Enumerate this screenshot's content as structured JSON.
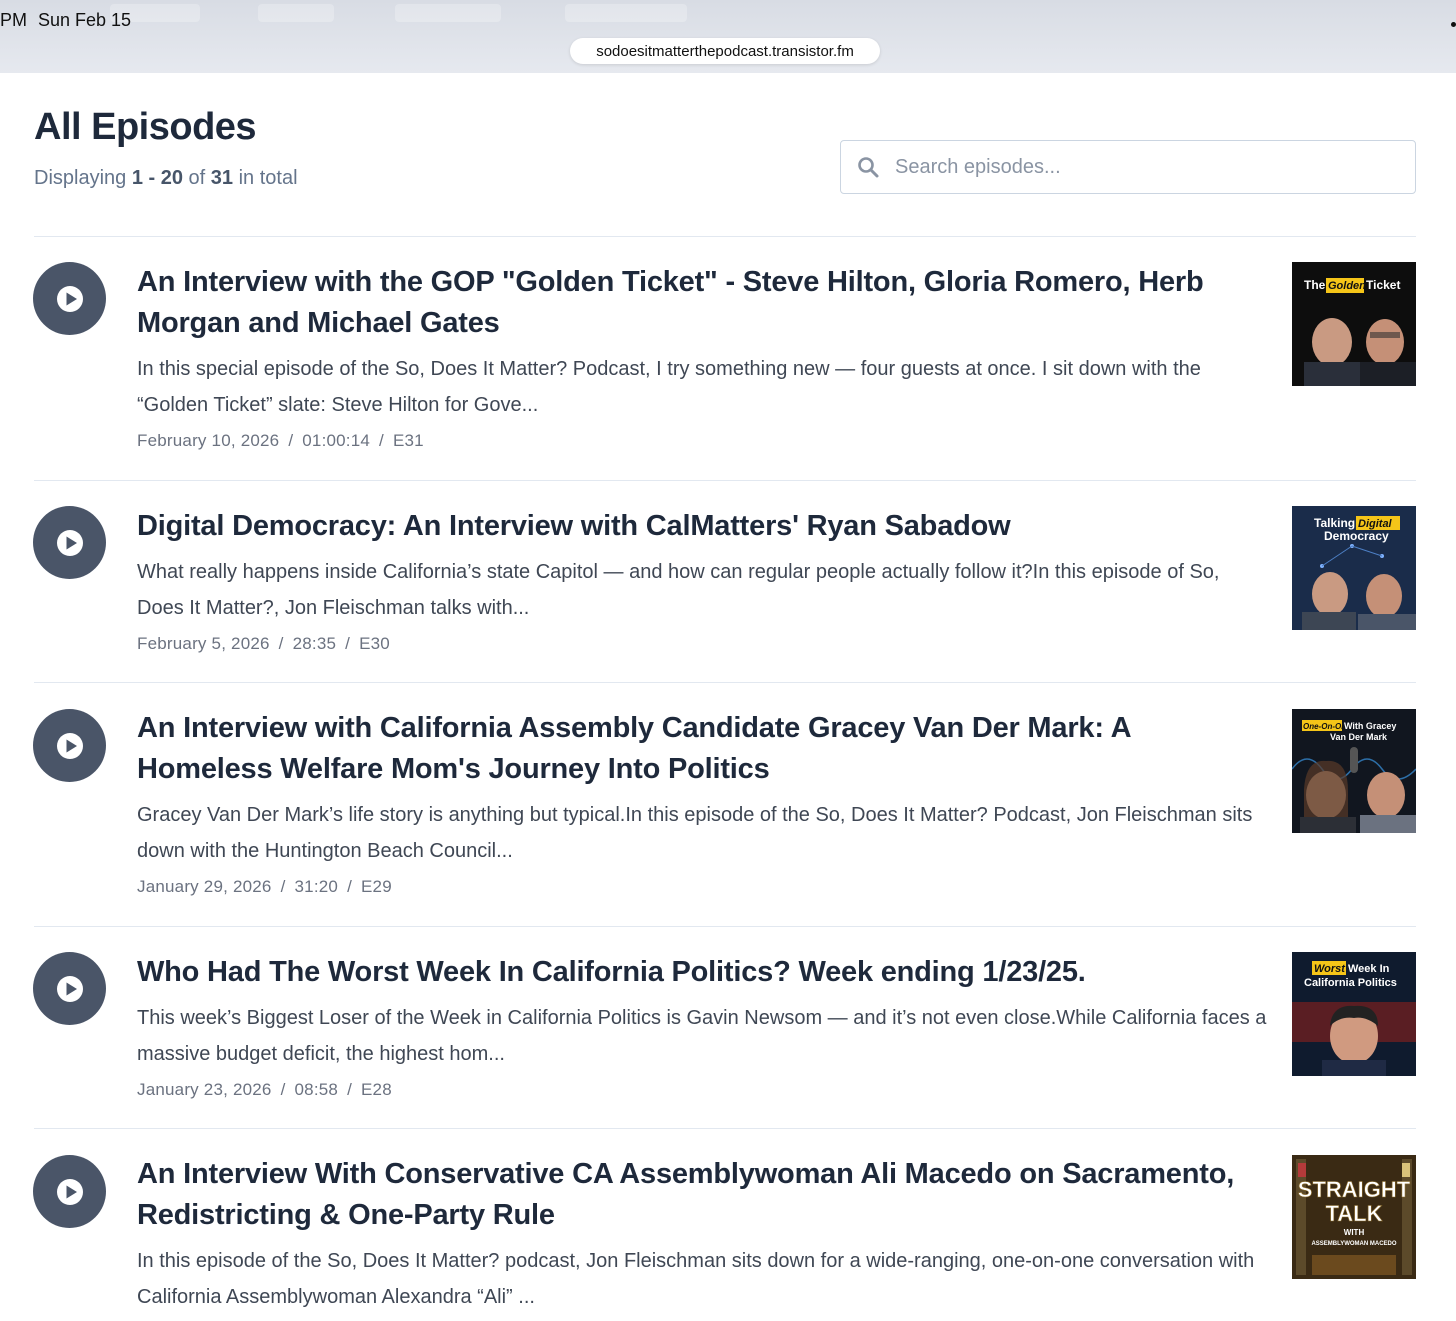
{
  "status_bar": {
    "time": "PM",
    "date": "Sun Feb 15"
  },
  "browser": {
    "url": "sodoesitmatterthepodcast.transistor.fm"
  },
  "header": {
    "title": "All Episodes",
    "displaying_prefix": "Displaying",
    "range": "1 - 20",
    "of_word": "of",
    "total": "31",
    "suffix": "in total"
  },
  "search": {
    "placeholder": "Search episodes..."
  },
  "episodes": [
    {
      "title": "An Interview with the GOP \"Golden Ticket\" - Steve Hilton, Gloria Romero, Herb Morgan and Michael Gates",
      "description": "In this special episode of the So, Does It Matter? Podcast, I try something new — four guests at once. I sit down with the “Golden Ticket” slate: Steve Hilton for Gove...",
      "date": "February 10, 2026",
      "duration": "01:00:14",
      "number": "E31",
      "thumb_lines": [
        "The",
        "Golden",
        "Ticket"
      ]
    },
    {
      "title": "Digital Democracy: An Interview with CalMatters' Ryan Sabadow",
      "description": "What really happens inside California’s state Capitol — and how can regular people actually follow it?In this episode of So, Does It Matter?, Jon Fleischman talks with...",
      "date": "February 5, 2026",
      "duration": "28:35",
      "number": "E30",
      "thumb_lines": [
        "Talking",
        "Digital",
        "Democracy"
      ]
    },
    {
      "title": "An Interview with California Assembly Candidate Gracey Van Der Mark: A Homeless Welfare Mom's Journey Into Politics",
      "description": "Gracey Van Der Mark’s life story is anything but typical.In this episode of the So, Does It Matter? Podcast, Jon Fleischman sits down with the Huntington Beach Council...",
      "date": "January 29, 2026",
      "duration": "31:20",
      "number": "E29",
      "thumb_lines": [
        "One-On-One",
        "With Gracey",
        "Van Der Mark"
      ]
    },
    {
      "title": "Who Had The Worst Week In California Politics? Week ending 1/23/25.",
      "description": "This week’s Biggest Loser of the Week in California Politics is Gavin Newsom — and it’s not even close.While California faces a massive budget deficit, the highest hom...",
      "date": "January 23, 2026",
      "duration": "08:58",
      "number": "E28",
      "thumb_lines": [
        "Worst",
        "Week In",
        "California Politics"
      ]
    },
    {
      "title": "An Interview With Conservative CA Assemblywoman Ali Macedo on Sacramento, Redistricting & One-Party Rule",
      "description": "In this episode of the So, Does It Matter? podcast, Jon Fleischman sits down for a wide-ranging, one-on-one conversation with California Assemblywoman Alexandra “Ali” ...",
      "thumb_lines": [
        "STRAIGHT",
        "TALK",
        "WITH",
        "ASSEMBLYWOMAN MACEDO"
      ]
    }
  ],
  "colors": {
    "play_button": "#4a5568",
    "title": "#1e293b",
    "meta": "#6b7280",
    "highlight": "#f5c518"
  }
}
